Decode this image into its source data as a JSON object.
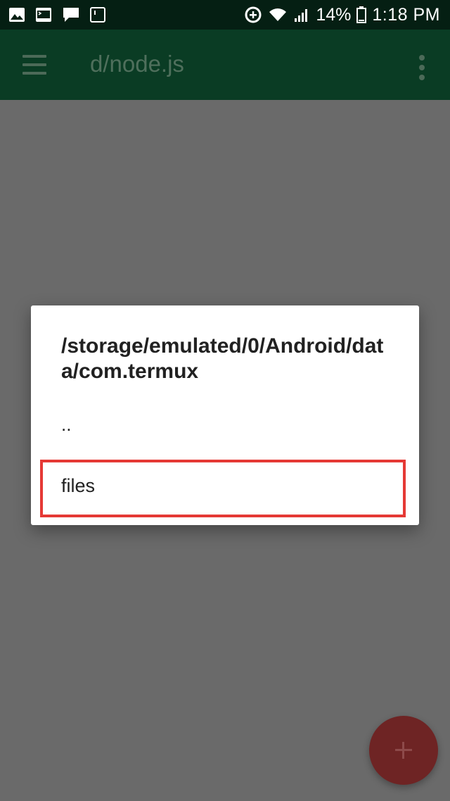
{
  "status_bar": {
    "battery": "14%",
    "time": "1:18 PM",
    "icons": [
      "image-icon",
      "terminal-icon",
      "message-icon",
      "phone-icon",
      "data-saver-icon",
      "wifi-icon",
      "signal-icon",
      "battery-icon"
    ]
  },
  "app_bar": {
    "title": "d/node.js",
    "menu_icon": "menu-icon",
    "overflow_icon": "more-vert-icon"
  },
  "dialog": {
    "path": "/storage/emulated/0/Android/data/com.termux",
    "items": [
      {
        "label": ".."
      },
      {
        "label": "files"
      }
    ]
  },
  "fab": {
    "icon": "plus-icon",
    "color": "#6e2424"
  },
  "colors": {
    "status_bar": "#051f13",
    "app_bar": "#0a3c24",
    "scrim": "#6a6a6a",
    "highlight": "#e53935"
  }
}
